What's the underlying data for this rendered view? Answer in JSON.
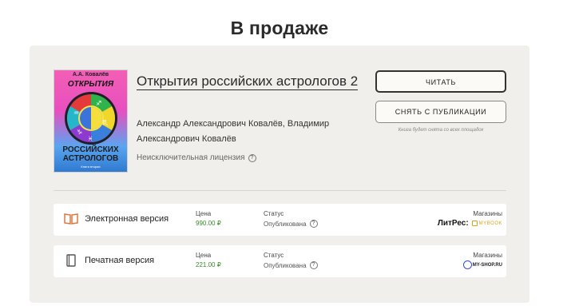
{
  "page_title": "В продаже",
  "book": {
    "title": "Открытия российских астрологов 2",
    "authors": "Александр Александрович Ковалёв, Владимир Александрович Ковалёв",
    "license": "Неисключительная лицензия",
    "cover": {
      "author": "А.А. Ковалёв",
      "title_top": "ОТКРЫТИЯ",
      "title_bottom_1": "РОССИЙСКИХ",
      "title_bottom_2": "АСТРОЛОГОВ",
      "subtitle": "Книга вторая"
    }
  },
  "actions": {
    "read_label": "ЧИТАТЬ",
    "unpublish_label": "СНЯТЬ С ПУБЛИКАЦИИ",
    "unpublish_note": "Книга будет снята со всех площадок"
  },
  "versions": [
    {
      "name": "Электронная версия",
      "price_label": "Цена",
      "price": "990.00 ₽",
      "status_label": "Статус",
      "status": "Опубликована",
      "stores_label": "Магазины",
      "stores": [
        "ЛитРес:",
        "MYBOOK"
      ]
    },
    {
      "name": "Печатная версия",
      "price_label": "Цена",
      "price": "221.00 ₽",
      "status_label": "Статус",
      "status": "Опубликована",
      "stores_label": "Магазины",
      "stores": [
        "MY-SHOP.RU"
      ]
    }
  ],
  "colors": {
    "panel_bg": "#f1efeb",
    "price_green": "#3d8b2a",
    "ebook_icon": "#e0763a",
    "mybook_gold": "#d9a21b",
    "myshop_blue": "#3a4fc9"
  }
}
